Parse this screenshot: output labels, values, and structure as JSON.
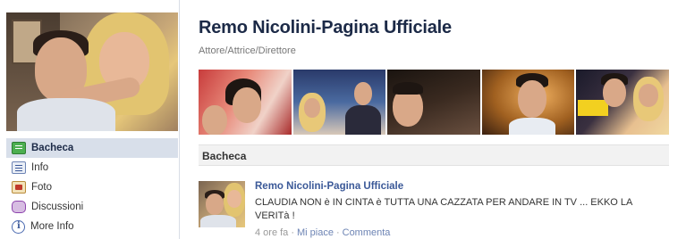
{
  "page": {
    "title": "Remo Nicolini-Pagina Ufficiale",
    "category": "Attore/Attrice/Direttore"
  },
  "sidebar": {
    "items": [
      {
        "label": "Bacheca",
        "icon": "wall-icon",
        "active": true
      },
      {
        "label": "Info",
        "icon": "info-icon",
        "active": false
      },
      {
        "label": "Foto",
        "icon": "photos-icon",
        "active": false
      },
      {
        "label": "Discussioni",
        "icon": "discussions-icon",
        "active": false
      },
      {
        "label": "More Info",
        "icon": "more-info-icon",
        "active": false
      }
    ]
  },
  "section": {
    "title": "Bacheca"
  },
  "post": {
    "author": "Remo Nicolini-Pagina Ufficiale",
    "text": "CLAUDIA NON è IN CINTA è TUTTA UNA CAZZATA PER ANDARE IN TV ... EKKO LA VERITà !",
    "time": "4 ore fa",
    "like_label": "Mi piace",
    "comment_label": "Commenta"
  },
  "colors": {
    "brand_link": "#3b5998",
    "title": "#1c2a47",
    "active_nav_bg": "#d8dfea"
  }
}
